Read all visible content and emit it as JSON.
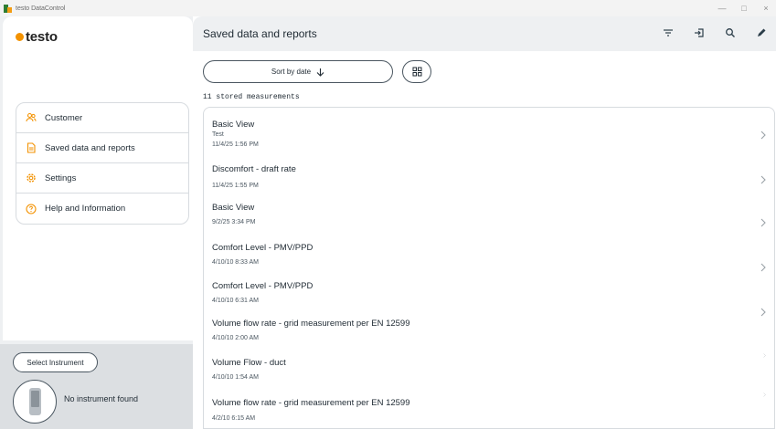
{
  "window": {
    "title": "testo DataControl",
    "controls": [
      "—",
      "□",
      "×"
    ]
  },
  "sidebar": {
    "logo_text": "testo",
    "brand_color": "#f39200",
    "items": [
      {
        "label": "Customer",
        "icon": "customers-icon"
      },
      {
        "label": "Saved data and reports",
        "icon": "document-icon"
      },
      {
        "label": "Settings",
        "icon": "gear-icon"
      },
      {
        "label": "Help and Information",
        "icon": "help-icon"
      }
    ],
    "instrument": {
      "select_label": "Select Instrument",
      "status": "No instrument found"
    }
  },
  "header": {
    "title": "Saved data and reports",
    "icons": [
      "filter-icon",
      "import-icon",
      "search-icon",
      "edit-icon"
    ]
  },
  "toolbar": {
    "sort_label": "Sort by date"
  },
  "list": {
    "count_text": "11 stored measurements",
    "items": [
      {
        "title": "Basic View",
        "subtitle": "Test",
        "date": "11/4/25 1:56 PM"
      },
      {
        "title": "Discomfort - draft rate",
        "subtitle": "",
        "date": "11/4/25 1:55 PM"
      },
      {
        "title": "Basic View",
        "subtitle": "",
        "date": "9/2/25 3:34 PM"
      },
      {
        "title": "Comfort Level - PMV/PPD",
        "subtitle": "",
        "date": "4/10/10 8:33 AM"
      },
      {
        "title": "Comfort Level - PMV/PPD",
        "subtitle": "",
        "date": "4/10/10 6:31 AM"
      },
      {
        "title": "Volume flow rate - grid measurement per EN 12599",
        "subtitle": "",
        "date": "4/10/10 2:00 AM"
      },
      {
        "title": "Volume Flow - duct",
        "subtitle": "",
        "date": "4/10/10 1:54 AM"
      },
      {
        "title": "Volume flow rate - grid measurement per EN 12599",
        "subtitle": "",
        "date": "4/2/10 6:15 AM"
      }
    ]
  }
}
